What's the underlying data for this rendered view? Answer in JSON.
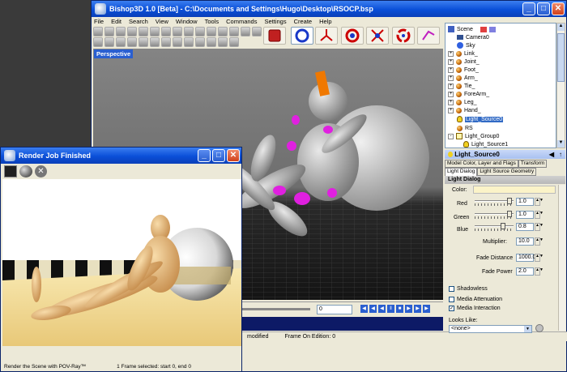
{
  "main_window": {
    "title": "Bishop3D 1.0 [Beta] - C:\\Documents and Settings\\Hugo\\Desktop\\RSOCP.bsp",
    "menu": [
      "File",
      "Edit",
      "Search",
      "View",
      "Window",
      "Tools",
      "Commands",
      "Settings",
      "Create",
      "Help"
    ],
    "viewport_label": "Perspective",
    "frame_value": "0",
    "status": [
      "modified",
      "Frame On Edition: 0"
    ]
  },
  "scene_tree": {
    "items": [
      {
        "label": "Scene",
        "icon": "scene-icon",
        "expander": false
      },
      {
        "label": "Camera0",
        "icon": "camera-icon",
        "expander": false
      },
      {
        "label": "Sky",
        "icon": "sky-icon",
        "expander": false
      },
      {
        "label": "Link_",
        "icon": "object-icon",
        "expander": true
      },
      {
        "label": "Joint_",
        "icon": "object-icon",
        "expander": true
      },
      {
        "label": "Foot_",
        "icon": "object-icon",
        "expander": true
      },
      {
        "label": "Arm_",
        "icon": "object-icon",
        "expander": true
      },
      {
        "label": "Tie_",
        "icon": "object-icon",
        "expander": true
      },
      {
        "label": "ForeArm_",
        "icon": "object-icon",
        "expander": true
      },
      {
        "label": "Leg_",
        "icon": "object-icon",
        "expander": true
      },
      {
        "label": "Hand_",
        "icon": "object-icon",
        "expander": true
      },
      {
        "label": "Light_Source0",
        "icon": "light-bulb-icon",
        "expander": false,
        "selected": true
      },
      {
        "label": "RS",
        "icon": "object-icon",
        "expander": false
      },
      {
        "label": "Light_Group0",
        "icon": "light-group-icon",
        "expander": true
      },
      {
        "label": "Light_Source1",
        "icon": "light-bulb-icon",
        "expander": false
      }
    ]
  },
  "properties": {
    "header": "Light_Source0",
    "tabs_row1": [
      "Model Color, Layer and Flags",
      "Transform"
    ],
    "tabs_row2": [
      "Light Dialog",
      "Light Source Geometry"
    ],
    "dialog_title": "Light Dialog",
    "color_label": "Color:",
    "red_label": "Red",
    "red_value": "1.0",
    "green_label": "Green",
    "green_value": "1.0",
    "blue_label": "Blue",
    "blue_value": "0.8",
    "multiplier_label": "Multiplier:",
    "multiplier_value": "10.0",
    "fade_distance_label": "Fade Distance",
    "fade_distance_value": "1000.0",
    "fade_power_label": "Fade Power",
    "fade_power_value": "2.0",
    "shadowless_label": "Shadowless",
    "media_attenuation_label": "Media Attenuation",
    "media_interaction_label": "Media Interaction",
    "looks_like_label": "Looks Like:",
    "looks_like_value": "<none>",
    "color_swatch": "#fbf3c8"
  },
  "render_window": {
    "title": "Render Job Finished",
    "status_left": "Render the Scene with POV-Ray™",
    "status_right": "1 Frame selected: start 0, end 0"
  }
}
